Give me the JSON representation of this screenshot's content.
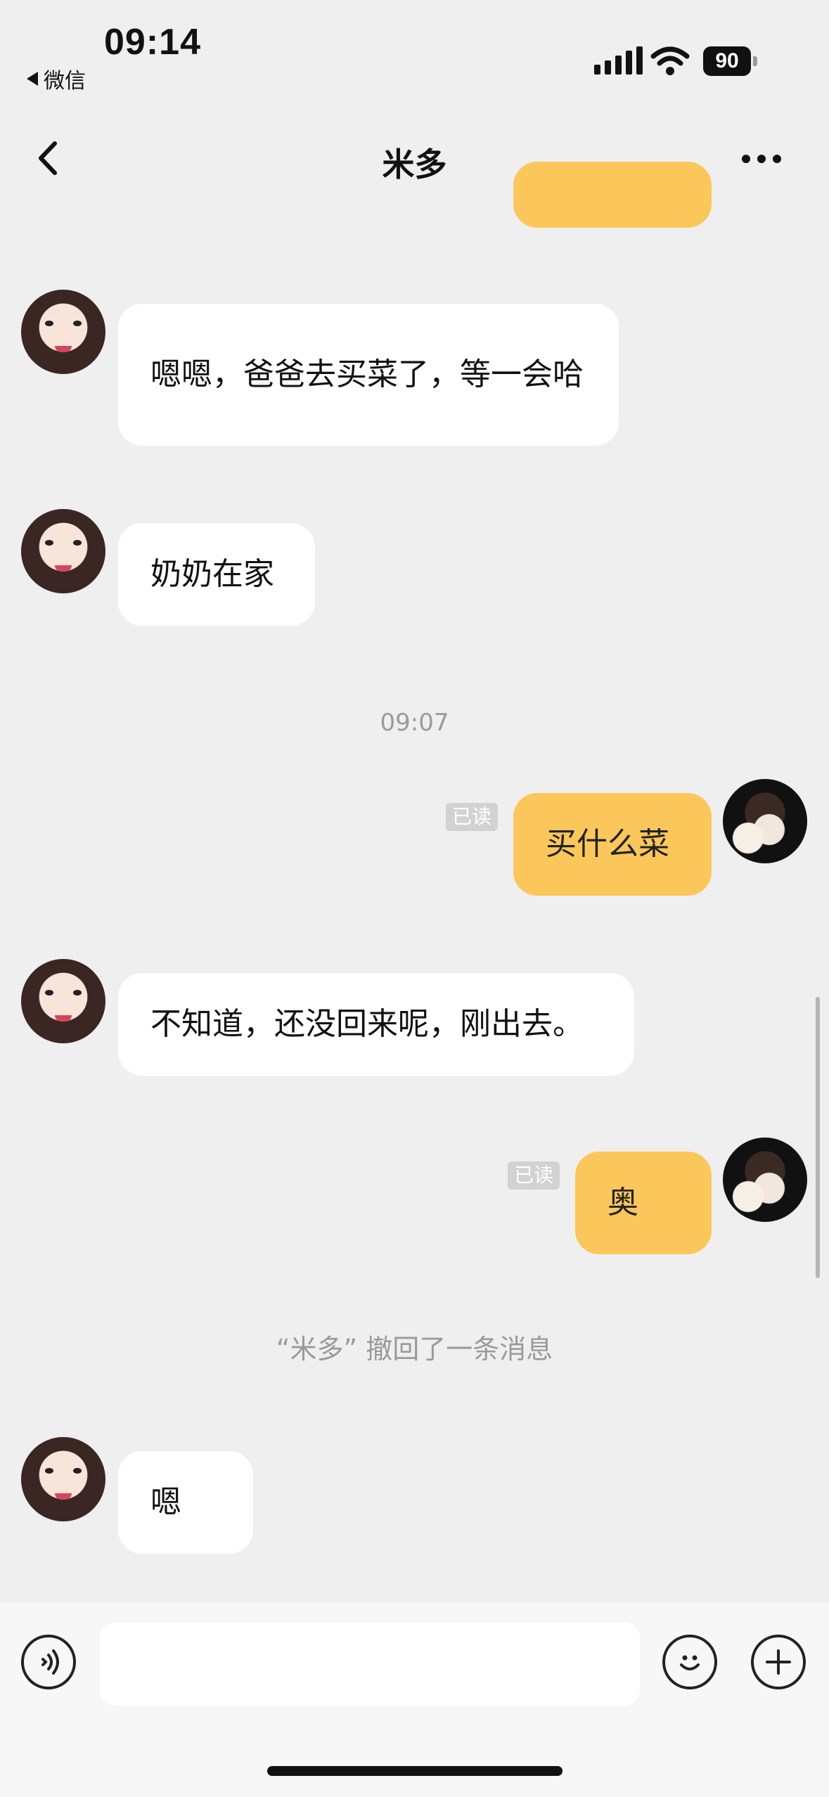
{
  "status_bar": {
    "time": "09:14",
    "back_app_label": "微信",
    "battery_level": "90"
  },
  "nav": {
    "title": "米多"
  },
  "messages": [
    {
      "side": "other",
      "text": "嗯嗯，爸爸去买菜了，等一会哈"
    },
    {
      "side": "other",
      "text": "奶奶在家"
    },
    {
      "side": "self",
      "text": "买什么菜",
      "read": "已读"
    },
    {
      "side": "other",
      "text": "不知道，还没回来呢，刚出去。"
    },
    {
      "side": "self",
      "text": "奥",
      "read": "已读"
    },
    {
      "side": "other",
      "text": "嗯"
    }
  ],
  "timestamp": "09:07",
  "system_note": "“米多” 撤回了一条消息",
  "input": {
    "value": "",
    "placeholder": ""
  },
  "colors": {
    "self_bubble": "#fbc75a",
    "other_bubble": "#ffffff",
    "background": "#efefef"
  }
}
